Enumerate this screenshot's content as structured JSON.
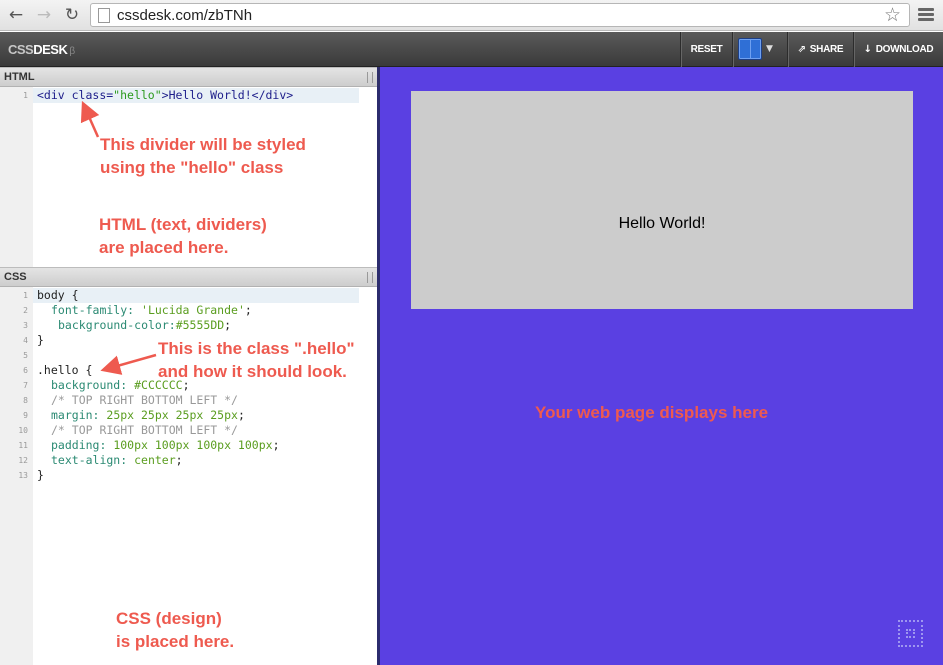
{
  "browser": {
    "back_icon": "arrow-left-icon",
    "forward_icon": "arrow-right-icon",
    "reload_icon": "reload-icon",
    "url": "cssdesk.com/zbTNh",
    "bookmark_icon": "star-icon",
    "menu_icon": "hamburger-menu-icon"
  },
  "app": {
    "logo_light": "CSS",
    "logo_bold": "DESK",
    "logo_mark": "β",
    "toolbar": {
      "reset_label": "RESET",
      "share_label": "SHARE",
      "download_label": "DOWNLOAD",
      "layout_icon": "layout-grid-icon",
      "share_icon": "external-link-icon",
      "download_icon": "download-arrow-icon"
    }
  },
  "html_panel": {
    "title": "HTML",
    "line_numbers": [
      "1"
    ],
    "code": {
      "l1_tag_open": "<div ",
      "l1_attr": "class=",
      "l1_str": "\"hello\"",
      "l1_rest": ">Hello World!</div>"
    }
  },
  "css_panel": {
    "title": "CSS",
    "line_numbers": [
      "1",
      "2",
      "3",
      "4",
      "5",
      "6",
      "7",
      "8",
      "9",
      "10",
      "11",
      "12",
      "13"
    ],
    "code": {
      "l1": "body {",
      "l2_prop": "font-family: ",
      "l2_val": "'Lucida Grande'",
      "l2_end": ";",
      "l3_prop": "background-color:",
      "l3_val": "#5555DD",
      "l3_end": ";",
      "l4": "}",
      "l6": ".hello {",
      "l7_prop": "background: ",
      "l7_val": "#CCCCCC",
      "l7_end": ";",
      "l8": "/* TOP RIGHT BOTTOM LEFT */",
      "l9_prop": "margin: ",
      "l9_val": "25px 25px 25px 25px",
      "l9_end": ";",
      "l10": "/* TOP RIGHT BOTTOM LEFT */",
      "l11_prop": "padding: ",
      "l11_val": "100px 100px 100px 100px",
      "l11_end": ";",
      "l12_prop": "text-align: ",
      "l12_val": "center",
      "l12_end": ";",
      "l13": "}"
    }
  },
  "preview": {
    "hello_text": "Hello World!",
    "background": "#5a40e2",
    "box_color": "#cccccc",
    "corner_icon": "cssdesk-corner-logo-icon"
  },
  "annotations": {
    "divider_note_1": "This divider will be styled",
    "divider_note_2": "using the \"hello\" class",
    "html_note_1": "HTML (text, dividers)",
    "html_note_2": "are placed here.",
    "class_note_1": "This is the class \".hello\"",
    "class_note_2": "and how it should look.",
    "css_note_1": "CSS (design)",
    "css_note_2": "is placed here.",
    "preview_note": "Your web page displays here",
    "color": "#ee5a4f"
  }
}
